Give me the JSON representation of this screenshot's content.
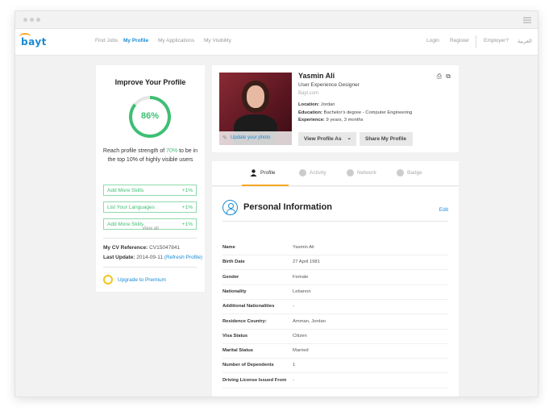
{
  "nav": {
    "logo": "bayt",
    "links": [
      "Find Jobs",
      "My Profile",
      "My Applications",
      "My Visibility"
    ],
    "right": [
      "Login",
      "Register",
      "Employer?",
      "العربية"
    ]
  },
  "improve": {
    "title": "Improve Your Profile",
    "percent": "86%",
    "percent_value": 86,
    "reach_a": "Reach profile strength of ",
    "reach_pct": "70%",
    "reach_b": " to be in the top 10% of highly visible users",
    "skills": [
      {
        "label": "Add More Skills",
        "pct": "+1%"
      },
      {
        "label": "List Your Languages",
        "pct": "+1%"
      },
      {
        "label": "Add More Skills",
        "pct": "+1%"
      }
    ],
    "view_all": "View all",
    "cv_ref_label": "My CV Reference:",
    "cv_ref_value": "CV15047841",
    "last_update_label": "Last Update:",
    "last_update_value": "2014-09-11",
    "refresh": "(Refresh Profile)",
    "premium": "Upgrade to Premium"
  },
  "profile": {
    "name": "Yasmin Ali",
    "title": "User Experience Designer",
    "site": "Bayt.com",
    "location_label": "Location:",
    "location": "Jordan",
    "education_label": "Education:",
    "education": "Bachelor's degree - Computer Engineering",
    "experience_label": "Experience:",
    "experience": "9 years, 3 months",
    "update_photo": "Update your photo",
    "view_as": "View Profile As",
    "share": "Share My Profile"
  },
  "tabs": [
    "Profile",
    "Activity",
    "Network",
    "Badge"
  ],
  "personal": {
    "title": "Personal Information",
    "edit": "Edit",
    "rows": [
      {
        "k": "Name",
        "v": "Yasmin Ali"
      },
      {
        "k": "Birth Date",
        "v": "27 April 1981"
      },
      {
        "k": "Gender",
        "v": "Female"
      },
      {
        "k": "Nationality",
        "v": "Lebanon"
      },
      {
        "k": "Additional Nationalities",
        "v": "-"
      },
      {
        "k": "Residence Country:",
        "v": "Amman, Jordan"
      },
      {
        "k": "Visa Status",
        "v": "Citizen"
      },
      {
        "k": "Marital Status",
        "v": "Married"
      },
      {
        "k": "Number of Dependents",
        "v": "1"
      },
      {
        "k": "Driving License Issued From",
        "v": "-"
      }
    ]
  }
}
